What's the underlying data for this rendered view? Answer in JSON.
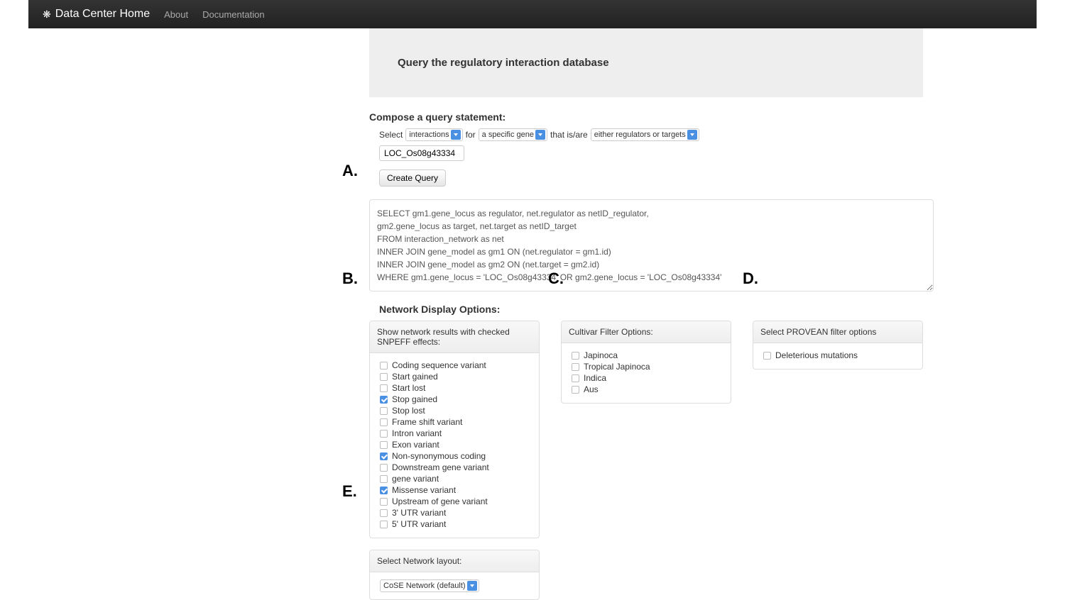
{
  "navbar": {
    "brand": "Data Center Home",
    "links": [
      "About",
      "Documentation"
    ]
  },
  "hero": {
    "title": "Query the regulatory interaction database"
  },
  "compose": {
    "title": "Compose a query statement:",
    "prefix": "Select",
    "select1": "interactions",
    "mid1": "for",
    "select2": "a specific gene",
    "mid2": "that is/are",
    "select3": "either regulators or targets",
    "gene_value": "LOC_Os08g43334",
    "create_label": "Create Query"
  },
  "sql_text": "SELECT gm1.gene_locus as regulator, net.regulator as netID_regulator,\ngm2.gene_locus as target, net.target as netID_target\nFROM interaction_network as net\nINNER JOIN gene_model as gm1 ON (net.regulator = gm1.id)\nINNER JOIN gene_model as gm2 ON (net.target = gm2.id)\nWHERE gm1.gene_locus = 'LOC_Os08g43334' OR gm2.gene_locus = 'LOC_Os08g43334'",
  "network_display_title": "Network Display Options:",
  "panels": {
    "snpeff": {
      "header": "Show network results with checked SNPEFF effects:",
      "items": [
        {
          "label": "Coding sequence variant",
          "checked": false
        },
        {
          "label": "Start gained",
          "checked": false
        },
        {
          "label": "Start lost",
          "checked": false
        },
        {
          "label": "Stop gained",
          "checked": true
        },
        {
          "label": "Stop lost",
          "checked": false
        },
        {
          "label": "Frame shift variant",
          "checked": false
        },
        {
          "label": "Intron variant",
          "checked": false
        },
        {
          "label": "Exon variant",
          "checked": false
        },
        {
          "label": "Non-synonymous coding",
          "checked": true
        },
        {
          "label": "Downstream gene variant",
          "checked": false
        },
        {
          "label": "gene variant",
          "checked": false
        },
        {
          "label": "Missense variant",
          "checked": true
        },
        {
          "label": "Upstream of gene variant",
          "checked": false
        },
        {
          "label": "3' UTR variant",
          "checked": false
        },
        {
          "label": "5' UTR variant",
          "checked": false
        }
      ]
    },
    "cultivar": {
      "header": "Cultivar Filter Options:",
      "items": [
        {
          "label": "Japinoca",
          "checked": false
        },
        {
          "label": "Tropical Japinoca",
          "checked": false
        },
        {
          "label": "Indica",
          "checked": false
        },
        {
          "label": "Aus",
          "checked": false
        }
      ]
    },
    "provean": {
      "header": "Select PROVEAN filter options",
      "items": [
        {
          "label": "Deleterious mutations",
          "checked": false
        }
      ]
    },
    "layout": {
      "header": "Select Network layout:",
      "selected": "CoSE Network (default)"
    }
  },
  "annotations": {
    "a": "A.",
    "b": "B.",
    "c": "C.",
    "d": "D.",
    "e": "E."
  }
}
